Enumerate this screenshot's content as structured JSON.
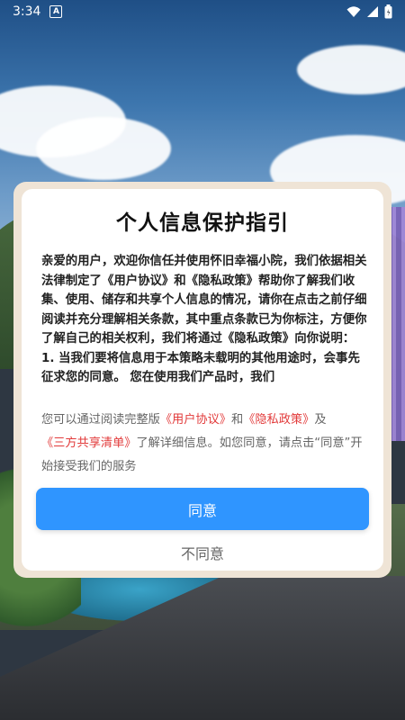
{
  "status_bar": {
    "time": "3:34",
    "notification_glyph": "A",
    "icons": [
      "wifi-icon",
      "signal-icon",
      "battery-icon"
    ]
  },
  "dialog": {
    "title": "个人信息保护指引",
    "body": "亲爱的用户，欢迎你信任并使用怀旧幸福小院，我们依据相关法律制定了《用户协议》和《隐私政策》帮助你了解我们收集、使用、储存和共享个人信息的情况，请你在点击之前仔细阅读并充分理解相关条款，其中重点条款已为你标注，方便你了解自己的相关权利，我们将通过《隐私政策》向你说明：",
    "body_item_1": "1. 当我们要将信息用于本策略未载明的其他用途时，会事先征求您的同意。 您在使用我们产品时，我们",
    "note": {
      "prefix": "您可以通过阅读完整版",
      "link_user_agreement": "《用户协议》",
      "and": "和",
      "link_privacy_policy": "《隐私政策》",
      "and2": "及",
      "link_third_party": "《三方共享清单》",
      "suffix": "了解详细信息。如您同意，请点击“同意”开始接受我们的服务"
    },
    "agree_label": "同意",
    "disagree_label": "不同意"
  },
  "colors": {
    "accent": "#2f95ff",
    "link": "#e23b3b",
    "frame": "#efe4d6"
  }
}
